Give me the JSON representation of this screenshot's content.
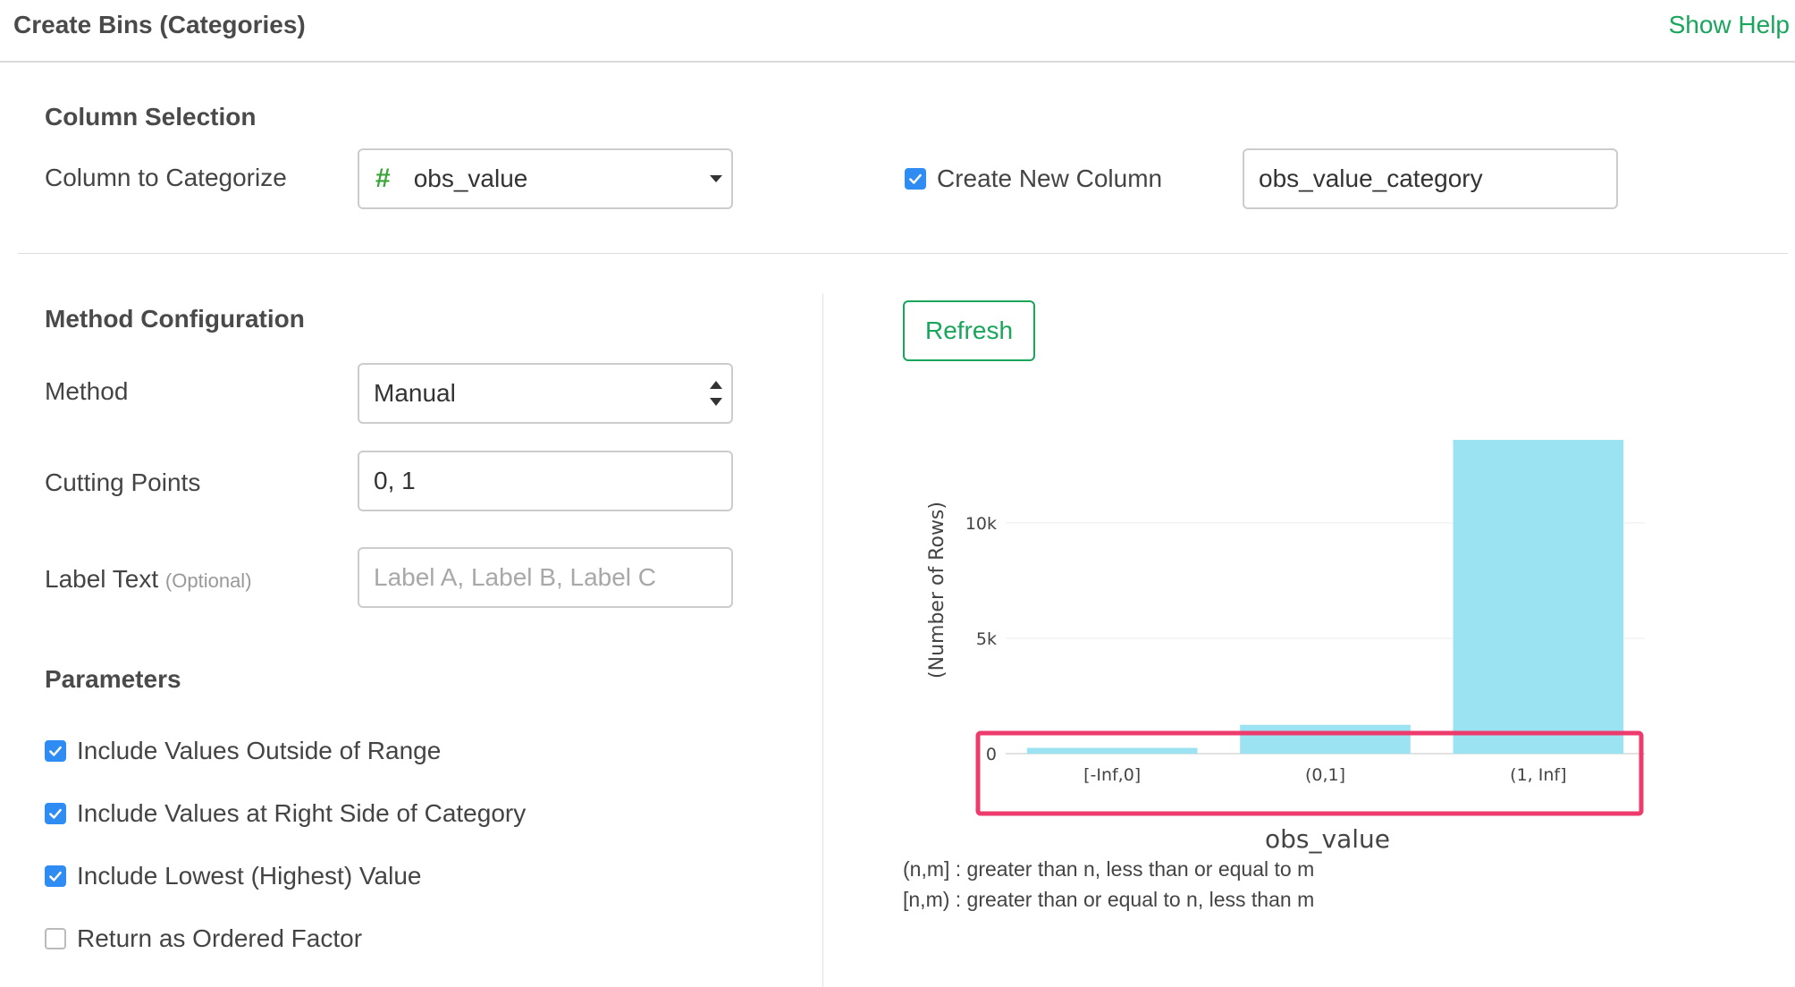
{
  "header": {
    "title": "Create Bins (Categories)",
    "help_link": "Show Help"
  },
  "column_selection": {
    "title": "Column Selection",
    "column_label": "Column to Categorize",
    "column_type_icon": "#",
    "column_value": "obs_value",
    "create_new_column_label": "Create New Column",
    "create_new_column_checked": true,
    "new_column_name": "obs_value_category"
  },
  "method_config": {
    "title": "Method Configuration",
    "method_label": "Method",
    "method_value": "Manual",
    "cutting_points_label": "Cutting Points",
    "cutting_points_value": "0, 1",
    "label_text_label": "Label Text",
    "label_text_optional": "(Optional)",
    "label_text_placeholder": "Label A, Label B, Label C"
  },
  "parameters": {
    "title": "Parameters",
    "options": [
      {
        "label": "Include Values Outside of Range",
        "checked": true
      },
      {
        "label": "Include Values at Right Side of Category",
        "checked": true
      },
      {
        "label": "Include Lowest (Highest) Value",
        "checked": true
      },
      {
        "label": "Return as Ordered Factor",
        "checked": false
      }
    ]
  },
  "preview": {
    "refresh_label": "Refresh",
    "notes": [
      "(n,m] : greater than n, less than or equal to m",
      "[n,m) : greater than or equal to n, less than m"
    ]
  },
  "colors": {
    "accent": "#1aa55c",
    "checkbox": "#2f8cf3",
    "bar": "#9be3f2",
    "highlight": "#ee3b6e"
  },
  "chart_data": {
    "type": "bar",
    "categories": [
      "[-Inf,0]",
      "(0,1]",
      "(1, Inf]"
    ],
    "values": [
      250,
      1250,
      13600
    ],
    "xlabel": "obs_value",
    "ylabel": "(Number of Rows)",
    "yticks": [
      0,
      5000,
      10000
    ],
    "ytick_labels": [
      "0",
      "5k",
      "10k"
    ],
    "ylim": [
      0,
      13600
    ],
    "grid": true,
    "legend": false
  }
}
